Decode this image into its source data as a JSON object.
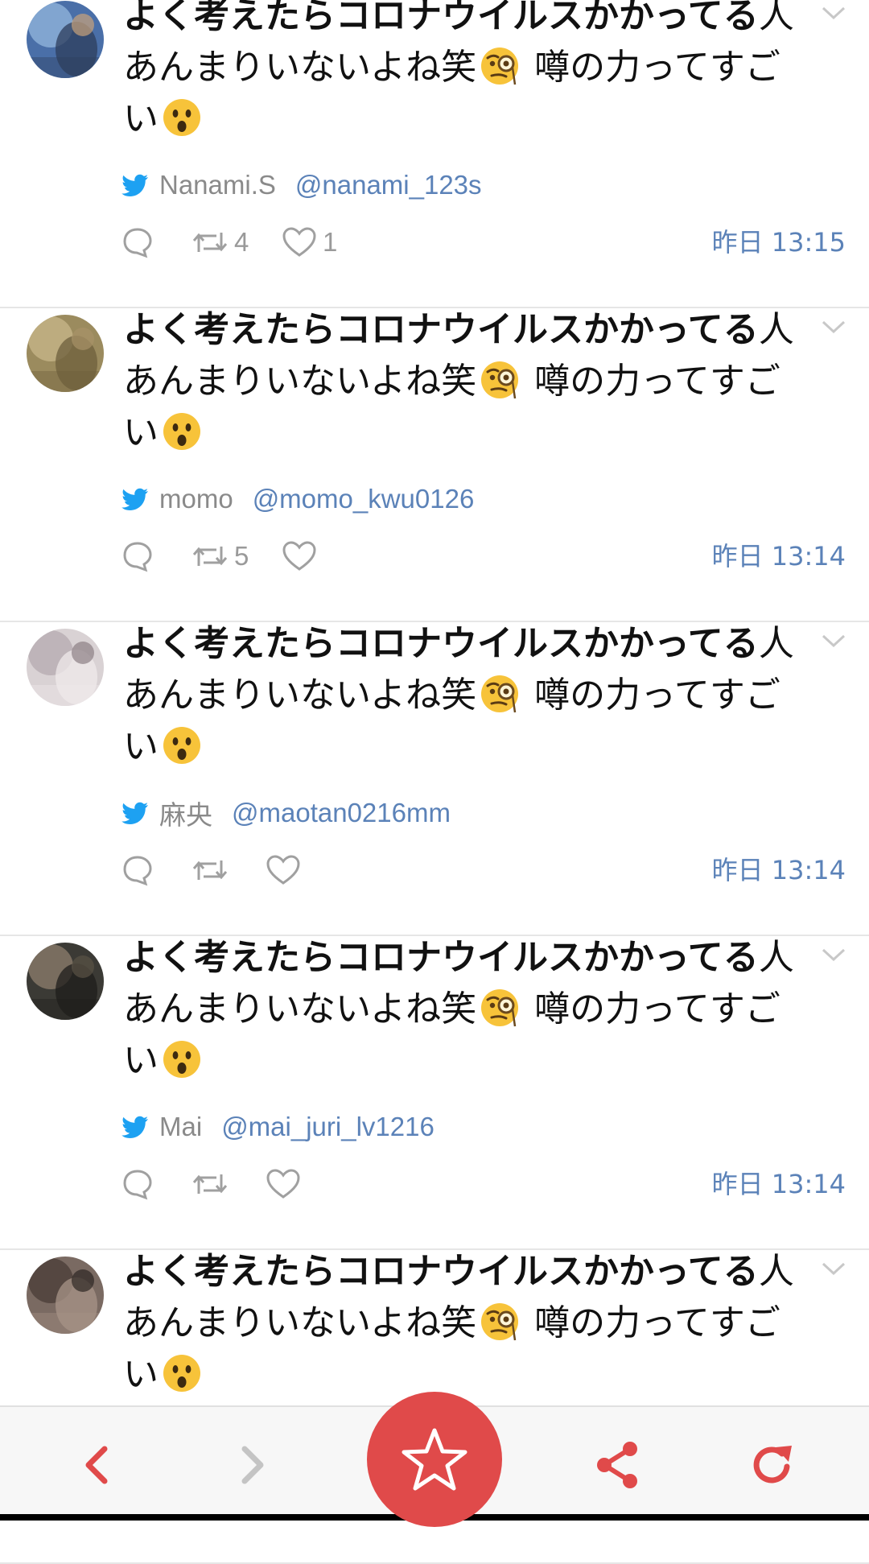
{
  "tweets": [
    {
      "text_bold": "よく考えたらコロナウイルスかかってる",
      "text_line1_rest": "人",
      "text_line2_pre": "あんまりいないよね笑",
      "text_line2_post": "噂の力ってすご",
      "text_line3": "い",
      "emoji1": "face-with-monocle",
      "emoji2": "hushed-face",
      "name": "Nanami.S",
      "handle": "@nanami_123s",
      "retweets": "4",
      "likes": "1",
      "time": "昨日 13:15"
    },
    {
      "text_bold": "よく考えたらコロナウイルスかかってる",
      "text_line1_rest": "人",
      "text_line2_pre": "あんまりいないよね笑",
      "text_line2_post": "噂の力ってすご",
      "text_line3": "い",
      "emoji1": "face-with-monocle",
      "emoji2": "hushed-face",
      "name": "momo",
      "handle": "@momo_kwu0126",
      "retweets": "5",
      "likes": "",
      "time": "昨日 13:14"
    },
    {
      "text_bold": "よく考えたらコロナウイルスかかってる",
      "text_line1_rest": "人",
      "text_line2_pre": "あんまりいないよね笑",
      "text_line2_post": "噂の力ってすご",
      "text_line3": "い",
      "emoji1": "face-with-monocle",
      "emoji2": "hushed-face",
      "name": "麻央",
      "handle": "@maotan0216mm",
      "retweets": "",
      "likes": "",
      "time": "昨日 13:14"
    },
    {
      "text_bold": "よく考えたらコロナウイルスかかってる",
      "text_line1_rest": "人",
      "text_line2_pre": "あんまりいないよね笑",
      "text_line2_post": "噂の力ってすご",
      "text_line3": "い",
      "emoji1": "face-with-monocle",
      "emoji2": "hushed-face",
      "name": "Mai",
      "handle": "@mai_juri_lv1216",
      "retweets": "",
      "likes": "",
      "time": "昨日 13:14"
    },
    {
      "text_bold": "よく考えたらコロナウイルスかかってる",
      "text_line1_rest": "人",
      "text_line2_pre": "あんまりいないよね笑",
      "text_line2_post": "噂の力ってすご",
      "text_line3": "い",
      "emoji1": "face-with-monocle",
      "emoji2": "hushed-face",
      "name": "",
      "handle": "",
      "retweets": "",
      "likes": "",
      "time": ""
    }
  ],
  "toolbar": {
    "back_icon": "chevron-left-icon",
    "forward_icon": "chevron-right-icon",
    "favorite_icon": "star-icon",
    "share_icon": "share-icon",
    "reload_icon": "reload-icon"
  },
  "colors": {
    "accent_red": "#e04a4a",
    "link_blue": "#5b82b8",
    "twitter_blue": "#1da1f2",
    "meta_gray": "#8a8a8a"
  }
}
